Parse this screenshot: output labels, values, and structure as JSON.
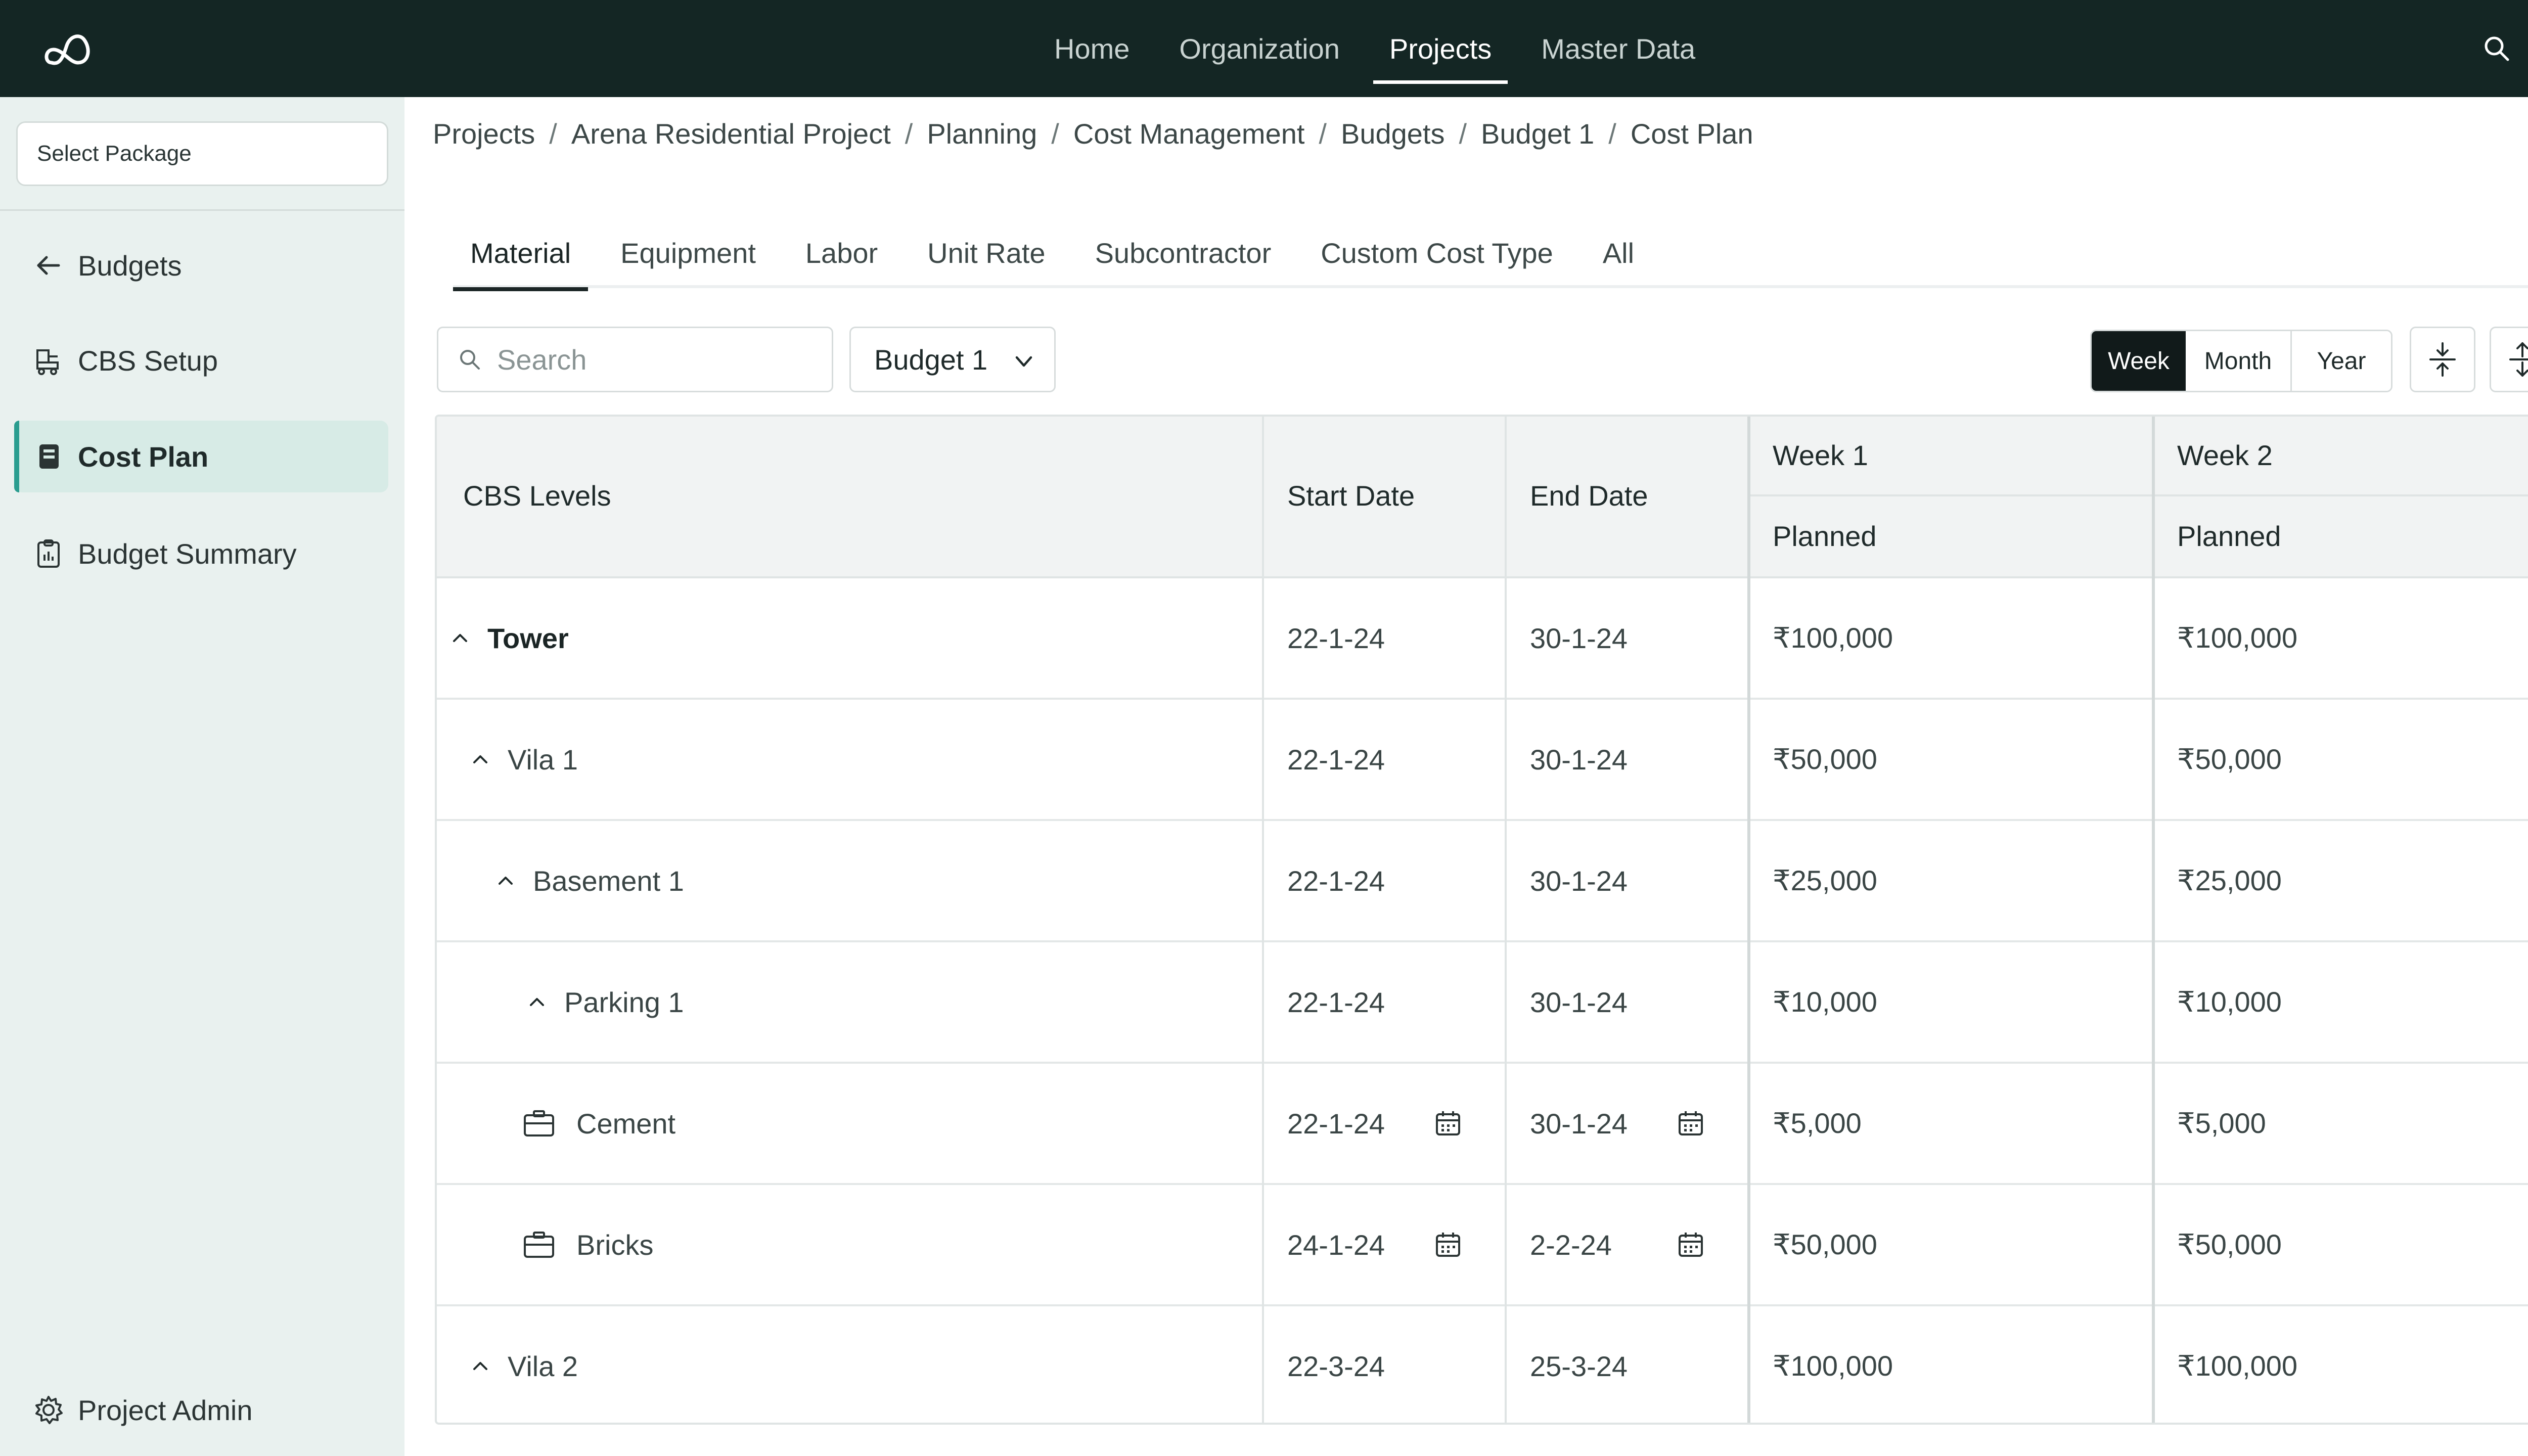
{
  "nav": {
    "items": [
      {
        "label": "Home"
      },
      {
        "label": "Organization"
      },
      {
        "label": "Projects"
      },
      {
        "label": "Master Data"
      }
    ],
    "active": "Projects"
  },
  "sidebar": {
    "package_placeholder": "Select Package",
    "back_label": "Budgets",
    "items": [
      {
        "label": "CBS Setup",
        "icon": "machine-icon"
      },
      {
        "label": "Cost Plan",
        "icon": "book-icon"
      },
      {
        "label": "Budget Summary",
        "icon": "clipboard-icon"
      }
    ],
    "active": "Cost Plan",
    "footer_label": "Project Admin"
  },
  "breadcrumb": [
    "Projects",
    "Arena Residential Project",
    "Planning",
    "Cost Management",
    "Budgets",
    "Budget 1",
    "Cost Plan"
  ],
  "tabs": [
    "Material",
    "Equipment",
    "Labor",
    "Unit Rate",
    "Subcontractor",
    "Custom Cost Type",
    "All"
  ],
  "active_tab": "Material",
  "toolbar": {
    "search_placeholder": "Search",
    "budget_value": "Budget 1",
    "period_options": [
      "Week",
      "Month",
      "Year"
    ],
    "active_period": "Week"
  },
  "table": {
    "headers": {
      "levels": "CBS Levels",
      "start": "Start Date",
      "end": "End Date",
      "week1": "Week 1",
      "week2": "Week 2",
      "planned1": "Planned",
      "planned2": "Planned"
    },
    "rows": [
      {
        "name": "Tower",
        "start": "22-1-24",
        "end": "30-1-24",
        "w1": "₹100,000",
        "w2": "₹100,000"
      },
      {
        "name": "Vila 1",
        "start": "22-1-24",
        "end": "30-1-24",
        "w1": "₹50,000",
        "w2": "₹50,000"
      },
      {
        "name": "Basement 1",
        "start": "22-1-24",
        "end": "30-1-24",
        "w1": "₹25,000",
        "w2": "₹25,000"
      },
      {
        "name": "Parking 1",
        "start": "22-1-24",
        "end": "30-1-24",
        "w1": "₹10,000",
        "w2": "₹10,000"
      },
      {
        "name": "Cement",
        "start": "22-1-24",
        "end": "30-1-24",
        "w1": "₹5,000",
        "w2": "₹5,000"
      },
      {
        "name": "Bricks",
        "start": "24-1-24",
        "end": "2-2-24",
        "w1": "₹50,000",
        "w2": "₹50,000"
      },
      {
        "name": "Vila 2",
        "start": "22-3-24",
        "end": "25-3-24",
        "w1": "₹100,000",
        "w2": "₹100,000"
      }
    ]
  },
  "colors": {
    "topbar": "#142624",
    "sidebar": "#e9f1ef",
    "accent": "#2a9d8f"
  }
}
